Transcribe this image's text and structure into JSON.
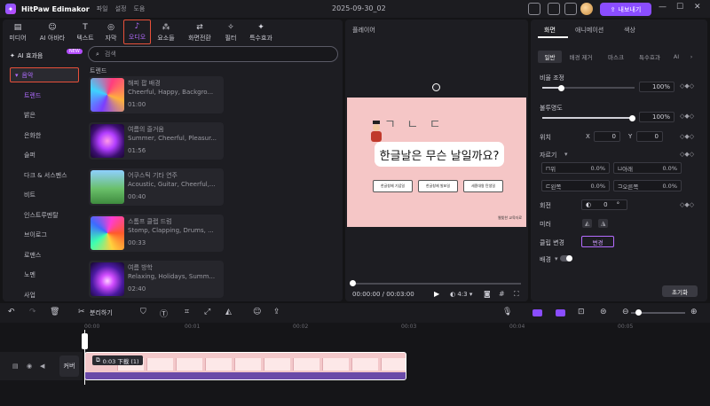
{
  "title_bar": {
    "app_title": "HitPaw Edimakor",
    "menus": [
      "파일",
      "설정",
      "도움"
    ],
    "project_date": "2025-09-30_02",
    "export_label": "내보내기"
  },
  "tools": [
    {
      "label": "미디어",
      "icon": "media-icon"
    },
    {
      "label": "AI 아바타",
      "icon": "ai-avatar-icon"
    },
    {
      "label": "텍스트",
      "icon": "text-icon"
    },
    {
      "label": "자막",
      "icon": "subtitle-icon"
    },
    {
      "label": "오디오",
      "icon": "audio-icon"
    },
    {
      "label": "요소들",
      "icon": "elements-icon"
    },
    {
      "label": "화면전환",
      "icon": "transition-icon"
    },
    {
      "label": "필터",
      "icon": "filter-icon"
    },
    {
      "label": "특수효과",
      "icon": "effects-icon"
    }
  ],
  "categories": {
    "ai_effect": "AI 효과음",
    "new_badge": "NEW",
    "music": "음악",
    "items": [
      "트렌드",
      "밝은",
      "은화한",
      "슬퍼",
      "다크 & 서스펜스",
      "비트",
      "인스트루멘탈",
      "브이로그",
      "로맨스",
      "노멘",
      "사업"
    ]
  },
  "search": {
    "placeholder": "검색"
  },
  "section_label": "트렌드",
  "tracks": [
    {
      "title": "해피 팝 배경",
      "desc": "Cheerful, Happy, Backgro...",
      "duration": "01:00"
    },
    {
      "title": "여름의 즐거움",
      "desc": "Summer, Cheerful, Pleasur...",
      "duration": "01:56"
    },
    {
      "title": "어쿠스틱 기타 연주",
      "desc": "Acoustic, Guitar, Cheerful,...",
      "duration": "00:40"
    },
    {
      "title": "스톰프 클랩 드럼",
      "desc": "Stomp, Clapping, Drums, ...",
      "duration": "00:33"
    },
    {
      "title": "여름 방학",
      "desc": "Relaxing, Holidays, Summ...",
      "duration": "02:40"
    }
  ],
  "player": {
    "title": "플레이어",
    "canvas_title": "한글날은 무슨 날일까요?",
    "letters": "ㄱ ㄴ ㄷ",
    "options": [
      "한글창제 기념일",
      "한글창제 발표일",
      "세종대왕 탄생일"
    ],
    "credit": "웹빛한 교육자료",
    "time": "00:00:00 / 00:03:00",
    "ratio": "4:3",
    "progress": 0
  },
  "right_panel": {
    "tabs": [
      "화면",
      "애니메이션",
      "색상"
    ],
    "subtabs": [
      "일반",
      "배경 제거",
      "마스크",
      "특수효과",
      "AI"
    ],
    "scale_label": "비율 조정",
    "scale_value": "100%",
    "opacity_label": "불투명도",
    "opacity_value": "100%",
    "position_label": "위치",
    "pos_x_label": "X",
    "pos_x": "0",
    "pos_y_label": "Y",
    "pos_y": "0",
    "crop_label": "자르기",
    "crop_top_label": "위",
    "crop_top": "0.0%",
    "crop_bottom_label": "아래",
    "crop_bottom": "0.0%",
    "crop_left_label": "왼쪽",
    "crop_left": "0.0%",
    "crop_right_label": "오른쪽",
    "crop_right": "0.0%",
    "rotate_label": "회전",
    "rotate_value": "0",
    "rotate_unit": "°",
    "mirror_label": "미러",
    "clip_change_label": "클립 변경",
    "change_btn": "변경",
    "bg_label": "배경",
    "reset_btn": "초기화"
  },
  "timeline": {
    "split_label": "분리하기",
    "ticks": [
      "00:00",
      "00:01",
      "00:02",
      "00:03",
      "00:04",
      "00:05"
    ],
    "clip_label": "0:03  下載 (1)",
    "cover_label": "커버"
  },
  "colors": {
    "accent": "#8a4dff",
    "highlight": "#e8503a",
    "canvas_bg": "#f5c6c6"
  }
}
